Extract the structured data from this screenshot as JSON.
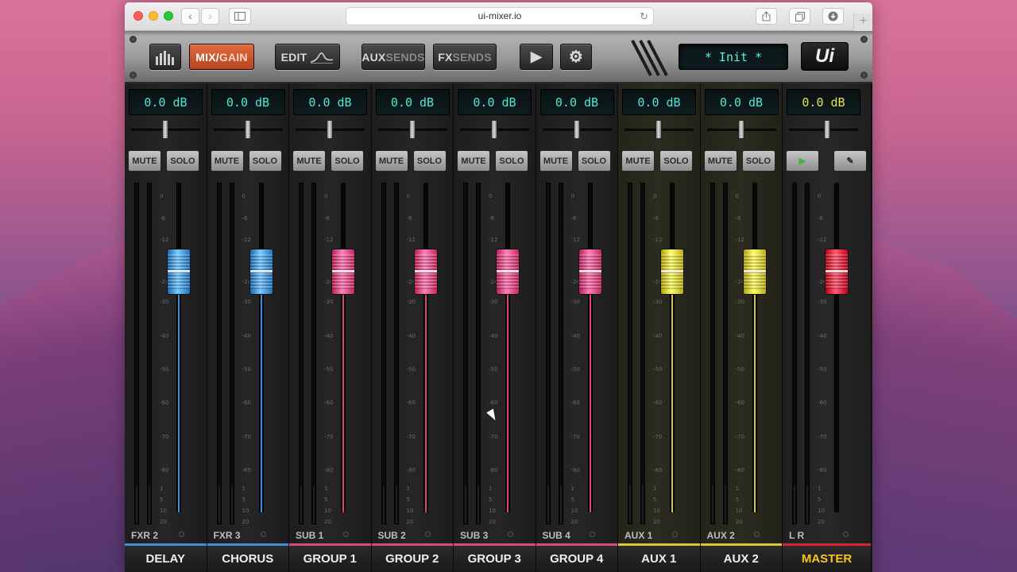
{
  "browser": {
    "url": "ui-mixer.io",
    "back_glyph": "‹",
    "forward_glyph": "›",
    "reload_glyph": "↻",
    "newtab_glyph": "+"
  },
  "toolbar": {
    "mix_label_a": "MIX/",
    "mix_label_b": "GAIN",
    "edit_label": "EDIT",
    "aux_label_a": "AUX",
    "aux_label_b": "SENDS",
    "fx_label_a": "FX",
    "fx_label_b": "SENDS",
    "play_glyph": "▶",
    "settings_glyph": "⚙",
    "preset": "* Init *",
    "logo": "Ui",
    "colors": {
      "active": "#d2552d",
      "lcd": "#4fe6d9"
    }
  },
  "scale_marks": [
    "0",
    "-6",
    "-12",
    "-24",
    "-30",
    "-40",
    "-50",
    "-60",
    "-70",
    "-80",
    "1",
    "5",
    "10",
    "20"
  ],
  "channels": [
    {
      "gain": "0.0 dB",
      "id": "FXR 2",
      "name": "DELAY",
      "mute": "MUTE",
      "solo": "SOLO",
      "color": "#3f8fd8"
    },
    {
      "gain": "0.0 dB",
      "id": "FXR 3",
      "name": "CHORUS",
      "mute": "MUTE",
      "solo": "SOLO",
      "color": "#3f8fd8"
    },
    {
      "gain": "0.0 dB",
      "id": "SUB 1",
      "name": "GROUP 1",
      "mute": "MUTE",
      "solo": "SOLO",
      "color": "#e0467e"
    },
    {
      "gain": "0.0 dB",
      "id": "SUB 2",
      "name": "GROUP 2",
      "mute": "MUTE",
      "solo": "SOLO",
      "color": "#e0467e"
    },
    {
      "gain": "0.0 dB",
      "id": "SUB 3",
      "name": "GROUP 3",
      "mute": "MUTE",
      "solo": "SOLO",
      "color": "#e0467e"
    },
    {
      "gain": "0.0 dB",
      "id": "SUB 4",
      "name": "GROUP 4",
      "mute": "MUTE",
      "solo": "SOLO",
      "color": "#e0467e"
    },
    {
      "gain": "0.0 dB",
      "id": "AUX 1",
      "name": "AUX 1",
      "mute": "MUTE",
      "solo": "SOLO",
      "color": "#d9c834"
    },
    {
      "gain": "0.0 dB",
      "id": "AUX 2",
      "name": "AUX 2",
      "mute": "MUTE",
      "solo": "SOLO",
      "color": "#d9c834"
    },
    {
      "gain": "0.0 dB",
      "id": "L  R",
      "name": "MASTER",
      "play": "▶",
      "edit": "✎",
      "color": "#e0213a"
    }
  ]
}
